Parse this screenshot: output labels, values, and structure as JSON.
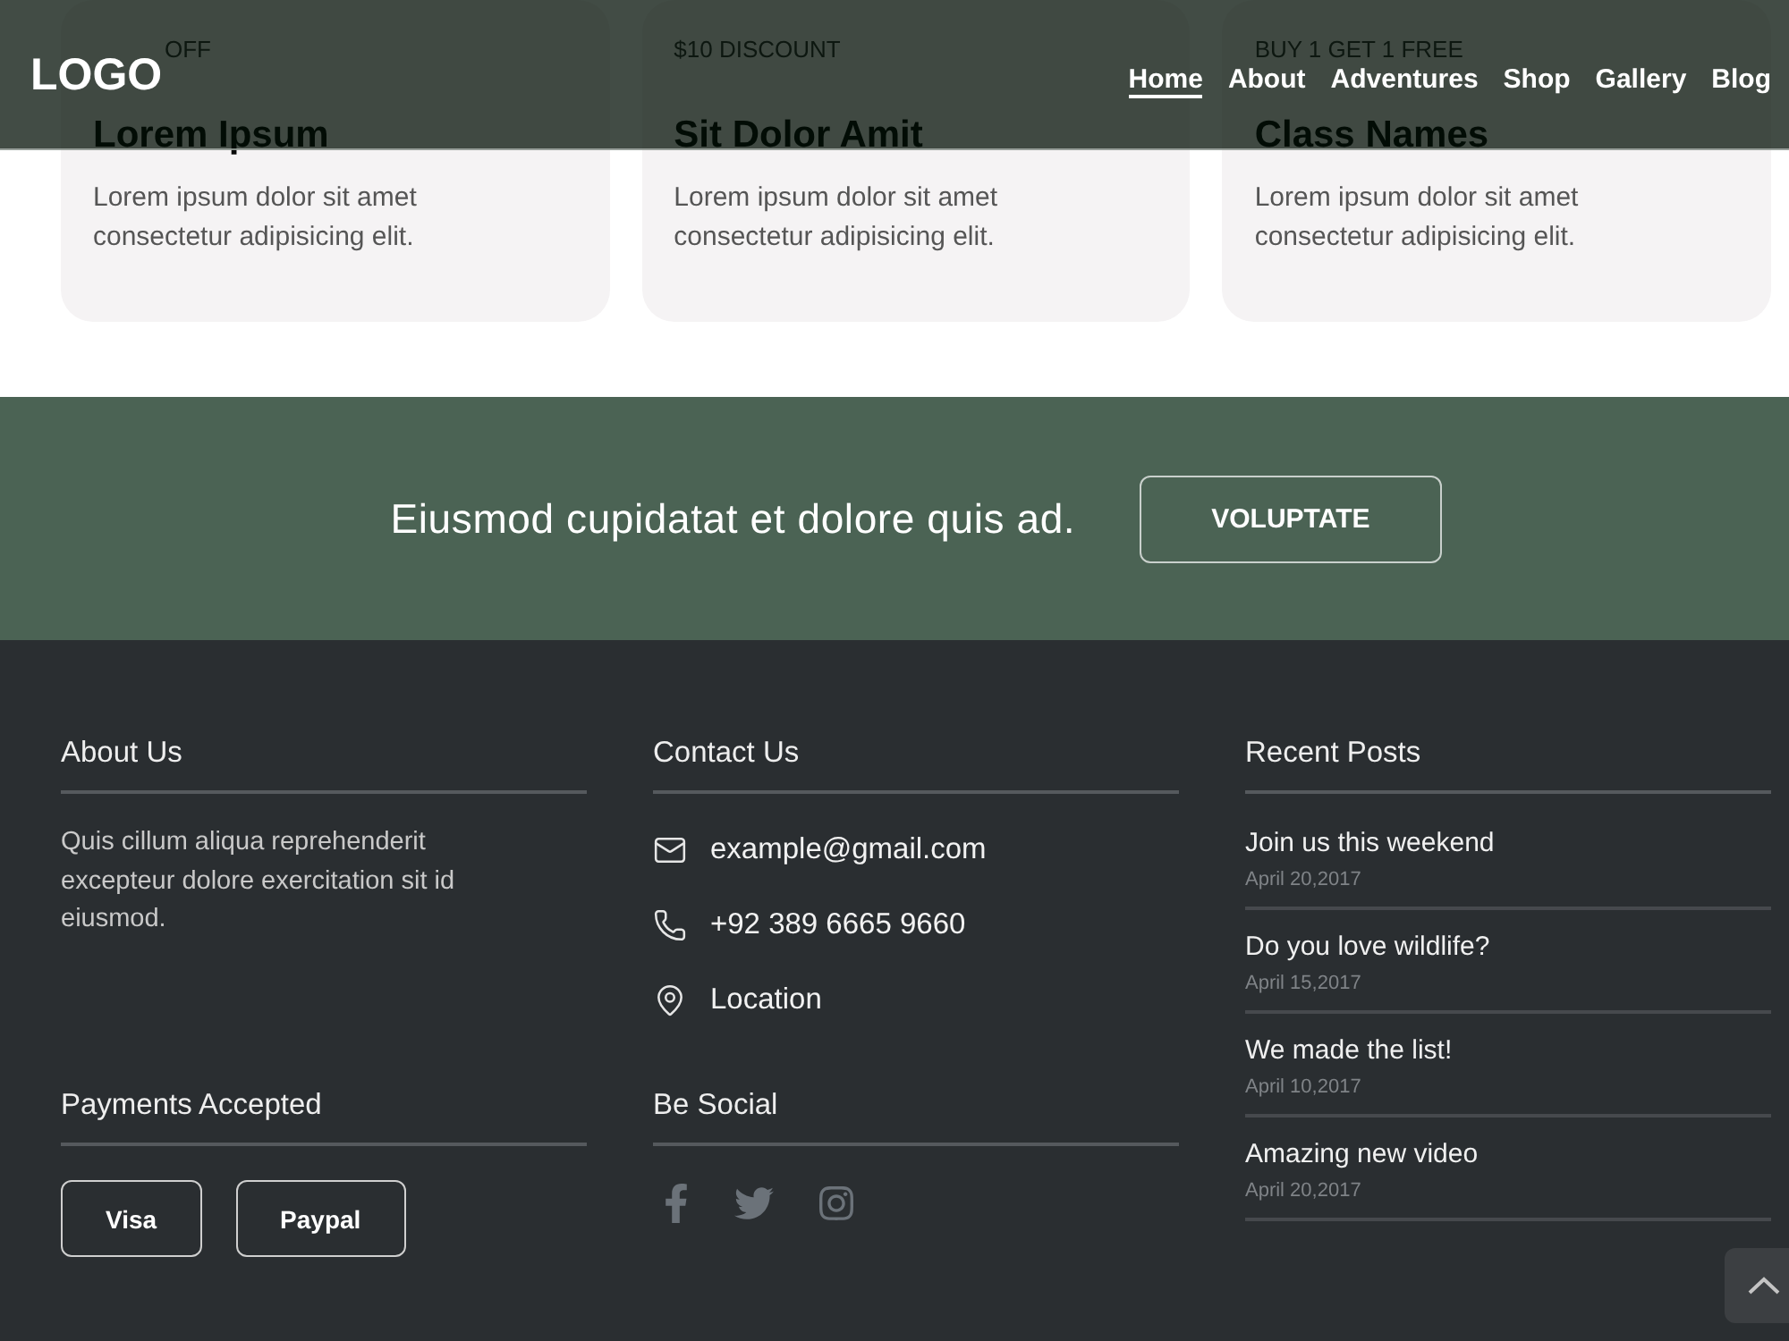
{
  "header": {
    "logo": "LOGO",
    "nav": [
      {
        "label": "Home",
        "selected": true
      },
      {
        "label": "About",
        "selected": false
      },
      {
        "label": "Adventures",
        "selected": false
      },
      {
        "label": "Shop",
        "selected": false
      },
      {
        "label": "Gallery",
        "selected": false
      },
      {
        "label": "Blog",
        "selected": false
      }
    ]
  },
  "offers": [
    {
      "tag": "OFF",
      "title": "Lorem Ipsum",
      "text": "Lorem ipsum dolor sit amet consectetur adipisicing elit."
    },
    {
      "tag": "$10 DISCOUNT",
      "title": "Sit Dolor Amit",
      "text": "Lorem ipsum dolor sit amet consectetur adipisicing elit."
    },
    {
      "tag": "BUY 1 GET 1 FREE",
      "title": "Class Names",
      "text": "Lorem ipsum dolor sit amet consectetur adipisicing elit."
    }
  ],
  "cta": {
    "text": "Eiusmod cupidatat et dolore quis ad.",
    "button": "VOLUPTATE"
  },
  "footer": {
    "about": {
      "heading": "About Us",
      "text": "Quis cillum aliqua reprehenderit excepteur dolore exercitation sit id eiusmod."
    },
    "contact": {
      "heading": "Contact Us",
      "items": [
        "example@gmail.com",
        "+92 389 6665 9660",
        "Location"
      ]
    },
    "recent_posts": {
      "heading": "Recent Posts",
      "posts": [
        {
          "title": "Join us this weekend",
          "date": "April 20,2017"
        },
        {
          "title": "Do you love wildlife?",
          "date": "April 15,2017"
        },
        {
          "title": "We made the list!",
          "date": "April 10,2017"
        },
        {
          "title": "Amazing new video",
          "date": "April 20,2017"
        }
      ]
    },
    "payments": {
      "heading": "Payments Accepted",
      "methods": [
        "Visa",
        "Paypal"
      ]
    },
    "social": {
      "heading": "Be Social"
    }
  }
}
